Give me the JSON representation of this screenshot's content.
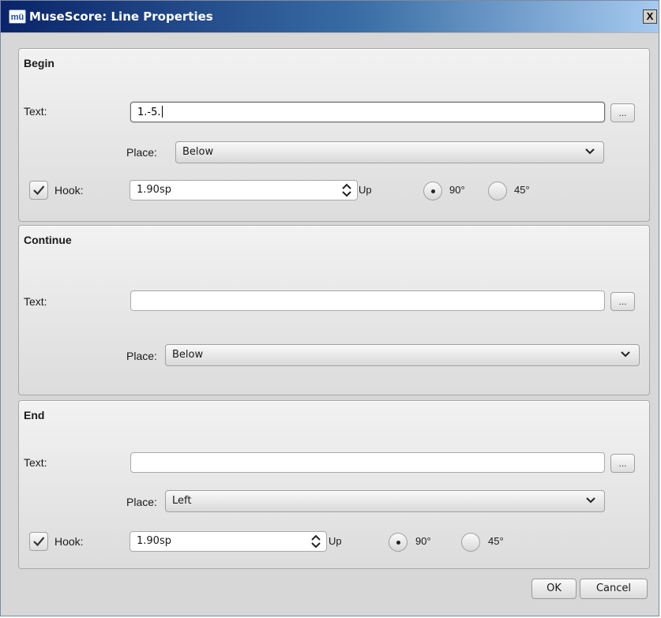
{
  "window": {
    "title": "MuseScore: Line Properties",
    "close_label": "X",
    "app_icon": "musescore-app-icon",
    "app_icon_text": "mü"
  },
  "begin": {
    "title": "Begin",
    "text_label": "Text:",
    "text_value": "1.-5.",
    "dots_label": "...",
    "place_label": "Place:",
    "place_value": "Below",
    "hook_label": "Hook:",
    "hook_checked": true,
    "hook_value": "1.90sp",
    "up_label": "Up",
    "angle_90": "90°",
    "angle_45": "45°",
    "angle_selected": "90°"
  },
  "continue": {
    "title": "Continue",
    "text_label": "Text:",
    "text_value": "",
    "dots_label": "...",
    "place_label": "Place:",
    "place_value": "Below"
  },
  "end": {
    "title": "End",
    "text_label": "Text:",
    "text_value": "",
    "dots_label": "...",
    "place_label": "Place:",
    "place_value": "Left",
    "hook_label": "Hook:",
    "hook_checked": true,
    "hook_value": "1.90sp",
    "up_label": "Up",
    "angle_90": "90°",
    "angle_45": "45°",
    "angle_selected": "90°"
  },
  "buttons": {
    "ok": "OK",
    "cancel": "Cancel"
  },
  "colors": {
    "titlebar_start": "#0a246a",
    "titlebar_end": "#a6caf0",
    "dialog_bg": "#d7d7d7"
  }
}
